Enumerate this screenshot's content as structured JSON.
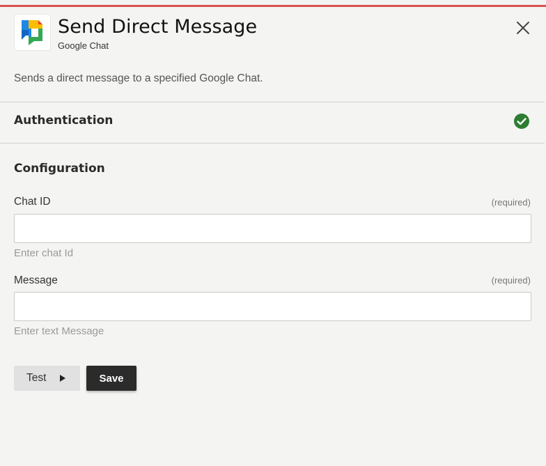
{
  "header": {
    "title": "Send Direct Message",
    "subtitle": "Google Chat",
    "logo_icon": "google-chat-icon",
    "close_icon": "close-icon"
  },
  "description": "Sends a direct message to a specified Google Chat.",
  "auth": {
    "label": "Authentication",
    "status_icon": "check-circle-icon",
    "status_color": "#2e7d32"
  },
  "config": {
    "title": "Configuration",
    "fields": [
      {
        "label": "Chat ID",
        "required_text": "(required)",
        "value": "",
        "hint": "Enter chat Id"
      },
      {
        "label": "Message",
        "required_text": "(required)",
        "value": "",
        "hint": "Enter text Message"
      }
    ]
  },
  "actions": {
    "test_label": "Test",
    "test_icon": "play-icon",
    "save_label": "Save"
  },
  "colors": {
    "accent_bar": "#d9534f",
    "background": "#f4f4f2",
    "save_button": "#2b2b2b"
  }
}
